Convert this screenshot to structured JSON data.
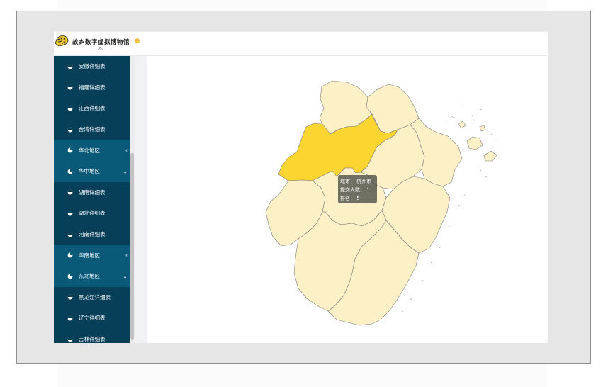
{
  "header": {
    "title": "故乡数字虚拟博物馆",
    "subtitle": "UST",
    "status_dot_color": "#f3c247"
  },
  "sidebar": {
    "items": [
      {
        "label": "安徽详细表",
        "type": "sub",
        "icon": "pie-chart-icon"
      },
      {
        "label": "福建详细表",
        "type": "sub",
        "icon": "pie-chart-icon"
      },
      {
        "label": "江西详细表",
        "type": "sub",
        "icon": "pie-chart-icon"
      },
      {
        "label": "台湾详细表",
        "type": "sub",
        "icon": "pie-chart-icon"
      },
      {
        "label": "华北地区",
        "type": "group",
        "icon": "pie-chart-icon",
        "chevron": "‹"
      },
      {
        "label": "华中地区",
        "type": "group",
        "icon": "pie-chart-icon",
        "chevron": "⌄"
      },
      {
        "label": "湖南详细表",
        "type": "sub",
        "icon": "pie-chart-icon"
      },
      {
        "label": "湖北详细表",
        "type": "sub",
        "icon": "pie-chart-icon"
      },
      {
        "label": "河南详细表",
        "type": "sub",
        "icon": "pie-chart-icon"
      },
      {
        "label": "华南地区",
        "type": "group",
        "icon": "pie-chart-icon",
        "chevron": "‹"
      },
      {
        "label": "东北地区",
        "type": "group",
        "icon": "pie-chart-icon",
        "chevron": "⌄"
      },
      {
        "label": "黑龙江详细表",
        "type": "sub",
        "icon": "pie-chart-icon"
      },
      {
        "label": "辽宁详细表",
        "type": "sub",
        "icon": "pie-chart-icon"
      },
      {
        "label": "吉林详细表",
        "type": "sub",
        "icon": "pie-chart-icon"
      }
    ]
  },
  "map": {
    "region_fill": "#fbf0c6",
    "highlight_fill": "#fcd530",
    "border_color": "#7a7a7a",
    "tooltip": {
      "city_label": "城市：",
      "city_value": "杭州市",
      "count_label": "提交人数：",
      "count_value": "1",
      "rank_label": "排名：",
      "rank_value": "5"
    }
  },
  "colors": {
    "sidebar_bg": "#073e58",
    "sidebar_group_bg": "#0b5978",
    "frame_bg": "#e6e6e6"
  }
}
